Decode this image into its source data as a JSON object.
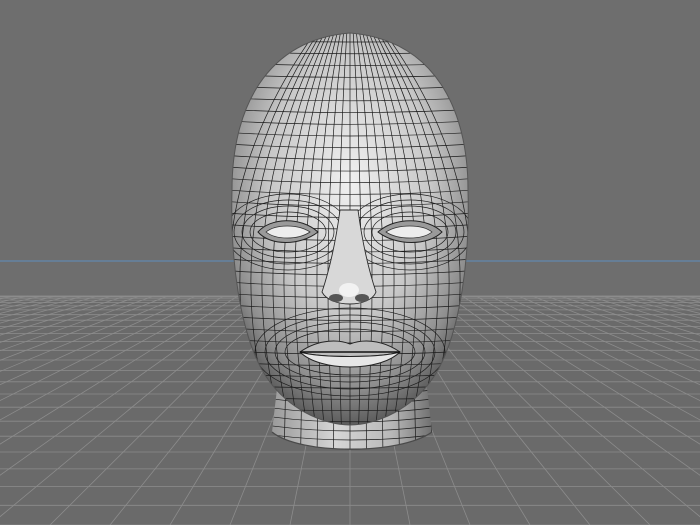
{
  "viewport": {
    "view": "perspective",
    "model": "head-mesh",
    "colors": {
      "background": "#6e6e6e",
      "horizon_line": "#5f8fbf",
      "floor_grid": "#8a8a8a",
      "mesh_wire": "#1a1a1a",
      "skin_light": "#e8e8e8",
      "skin_dark": "#6a6a6a"
    }
  }
}
